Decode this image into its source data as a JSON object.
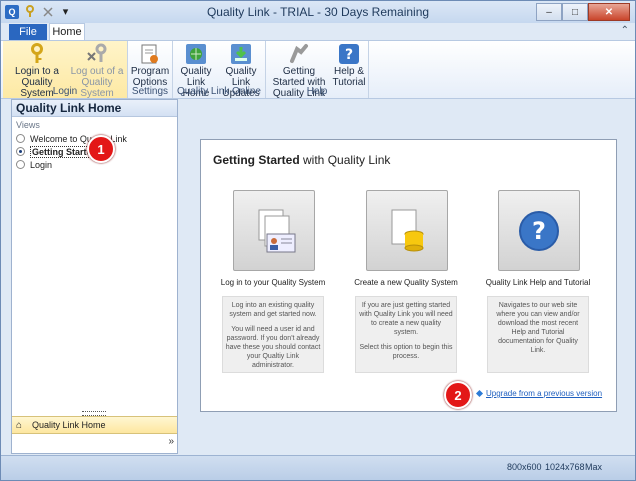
{
  "window": {
    "title": "Quality Link - TRIAL - 30 Days Remaining",
    "min": "‒",
    "max": "□",
    "close": "✕"
  },
  "tabs": {
    "file": "File",
    "home": "Home"
  },
  "ribbon": {
    "groups": [
      {
        "label": "Login",
        "buttons": [
          {
            "label": "Login to a Quality System",
            "icon": "key-icon"
          },
          {
            "label": "Log out of a Quality System",
            "icon": "logout-key-icon"
          }
        ]
      },
      {
        "label": "Settings",
        "buttons": [
          {
            "label": "Program Options",
            "icon": "options-icon"
          }
        ]
      },
      {
        "label": "Quality Link Online",
        "buttons": [
          {
            "label": "Quality Link Home",
            "icon": "globe-icon"
          },
          {
            "label": "Quality Link Updates",
            "icon": "download-icon"
          }
        ]
      },
      {
        "label": "Help",
        "buttons": [
          {
            "label": "Getting Started with Quality Link",
            "icon": "hands-icon"
          },
          {
            "label": "Help & Tutorial",
            "icon": "help-icon"
          }
        ]
      }
    ]
  },
  "leftpane": {
    "title": "Quality Link Home",
    "views_label": "Views",
    "views": [
      {
        "label": "Welcome to Quality Link",
        "selected": false
      },
      {
        "label": "Getting Started",
        "selected": true
      },
      {
        "label": "Login",
        "selected": false
      }
    ],
    "nav_item": "Quality Link Home",
    "more": "»"
  },
  "card": {
    "title_bold": "Getting Started",
    "title_rest": "with Quality Link",
    "options": [
      {
        "label": "Log in to your Quality System",
        "icon": "login-card-icon",
        "desc": [
          "Log into an existing quality system and get started now.",
          "You will need a user id and password. If you don't already have these you should contact your Qualtiy Link administrator."
        ]
      },
      {
        "label": "Create a new Quality System",
        "icon": "database-icon",
        "desc": [
          "If you are just getting started with Quality Link you will need to create a new quality system.",
          "Select this option to begin this process."
        ]
      },
      {
        "label": "Quality Link Help and Tutorial",
        "icon": "question-icon",
        "desc": [
          "Navigates to our web site where you can view and/or download the most recent Help and Tutorial documentation for Quality Link."
        ]
      }
    ],
    "upgrade_link": "Upgrade from a previous version"
  },
  "badges": {
    "one": "1",
    "two": "2"
  },
  "status": {
    "s1": "800x600",
    "s2": "1024x768",
    "s3": "Max"
  },
  "colors": {
    "badge": "#e31717",
    "link": "#1f5fbf",
    "file_tab": "#2a67c0"
  }
}
